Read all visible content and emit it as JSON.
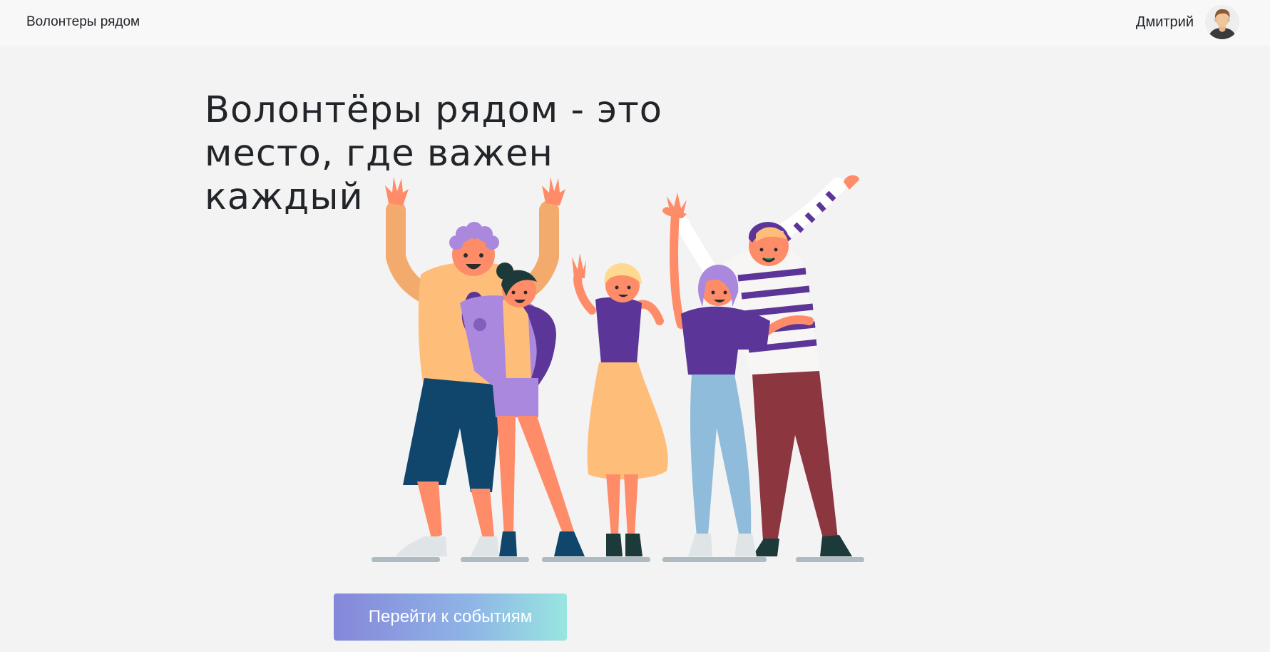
{
  "navbar": {
    "brand": "Волонтеры рядом",
    "user_name": "Дмитрий",
    "avatar_icon": "user-avatar-icon"
  },
  "hero": {
    "title": "Волонтёры рядом - это место, где важен каждый",
    "illustration_icon": "volunteers-group-illustration",
    "cta_label": "Перейти к событиям"
  },
  "colors": {
    "page_background": "#f4f3f3",
    "navbar_background": "#f8f8f9",
    "button_gradient_start": "#8587da",
    "button_gradient_end": "#98e6e0",
    "illustration_purple": "#5b3597",
    "illustration_peach": "#ffbd7a",
    "illustration_skin": "#ff8c69"
  }
}
